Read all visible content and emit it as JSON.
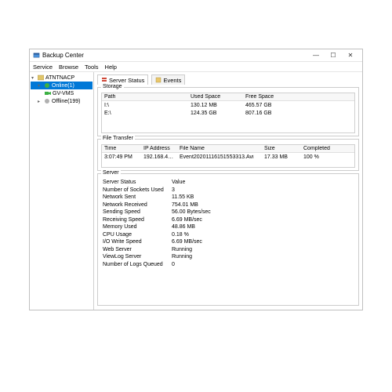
{
  "window": {
    "title": "Backup Center",
    "minimize": "—",
    "maximize": "☐",
    "close": "✕"
  },
  "menu": {
    "service": "Service",
    "browse": "Browse",
    "tools": "Tools",
    "help": "Help"
  },
  "tree": {
    "root": "ATNTNACP",
    "item_online": "Online(1)",
    "item_gvvms": "GV-VMS",
    "item_offline": "Offline(199)"
  },
  "tabs": {
    "server_status": "Server Status",
    "events": "Events"
  },
  "storage": {
    "label": "Storage",
    "headers": {
      "path": "Path",
      "used": "Used Space",
      "free": "Free Space"
    },
    "rows": [
      {
        "path": "I:\\",
        "used": "130.12 MB",
        "free": "465.57 GB"
      },
      {
        "path": "E:\\",
        "used": "124.35 GB",
        "free": "807.16 GB"
      }
    ]
  },
  "file_transfer": {
    "label": "File Transfer",
    "headers": {
      "time": "Time",
      "ip": "IP Address",
      "fname": "File Name",
      "size": "Size",
      "completed": "Completed"
    },
    "rows": [
      {
        "time": "3:07:49 PM",
        "ip": "192.168.4…",
        "fname": "Event20201116151553313.Avi",
        "size": "17.33 MB",
        "completed": "100 %"
      }
    ]
  },
  "server": {
    "label": "Server",
    "headers": {
      "status": "Server Status",
      "value": "Value"
    },
    "rows": [
      {
        "k": "Number of Sockets Used",
        "v": "3"
      },
      {
        "k": "Network Sent",
        "v": "11.55 KB"
      },
      {
        "k": "Network Received",
        "v": "754.01 MB"
      },
      {
        "k": "Sending Speed",
        "v": "56.00 Bytes/sec"
      },
      {
        "k": "Receiving Speed",
        "v": "6.69 MB/sec"
      },
      {
        "k": "Memory Used",
        "v": "48.86 MB"
      },
      {
        "k": "CPU Usage",
        "v": "0.18 %"
      },
      {
        "k": "I/O Write Speed",
        "v": "6.69 MB/sec"
      },
      {
        "k": "Web Server",
        "v": "Running"
      },
      {
        "k": "ViewLog Server",
        "v": "Running"
      },
      {
        "k": "Number of Logs Queued",
        "v": "0"
      }
    ]
  }
}
